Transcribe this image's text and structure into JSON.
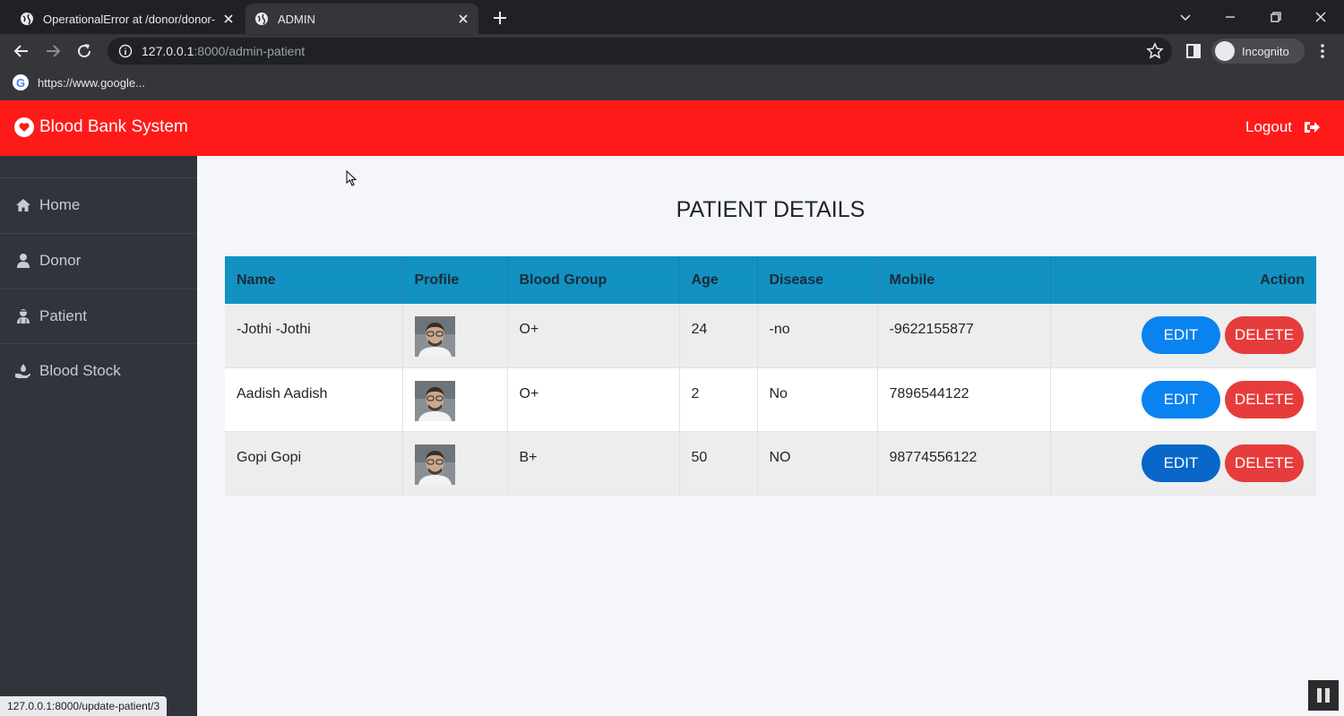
{
  "browser": {
    "tabs": [
      {
        "title": "OperationalError at /donor/donor-",
        "active": false
      },
      {
        "title": "ADMIN",
        "active": true
      }
    ],
    "url_host": "127.0.0.1",
    "url_rest": ":8000/admin-patient",
    "profile_label": "Incognito",
    "bookmark_label": "https://www.google..."
  },
  "app": {
    "brand": "Blood Bank System",
    "logout_label": "Logout",
    "accent_color": "#ff1a1a"
  },
  "sidebar": {
    "items": [
      {
        "label": "Home",
        "icon": "home-icon"
      },
      {
        "label": "Donor",
        "icon": "user-icon"
      },
      {
        "label": "Patient",
        "icon": "user-injured-icon"
      },
      {
        "label": "Blood Stock",
        "icon": "hand-holding-icon"
      }
    ]
  },
  "main": {
    "title": "PATIENT DETAILS",
    "columns": [
      "Name",
      "Profile",
      "Blood Group",
      "Age",
      "Disease",
      "Mobile",
      "Action"
    ],
    "rows": [
      {
        "name": "-Jothi -Jothi",
        "blood_group": "O+",
        "age": "24",
        "disease": "-no",
        "mobile": "-9622155877"
      },
      {
        "name": "Aadish Aadish",
        "blood_group": "O+",
        "age": "2",
        "disease": "No",
        "mobile": "7896544122"
      },
      {
        "name": "Gopi Gopi",
        "blood_group": "B+",
        "age": "50",
        "disease": "NO",
        "mobile": "98774556122"
      }
    ],
    "edit_label": "EDIT",
    "delete_label": "DELETE"
  },
  "status_url": "127.0.0.1:8000/update-patient/3"
}
